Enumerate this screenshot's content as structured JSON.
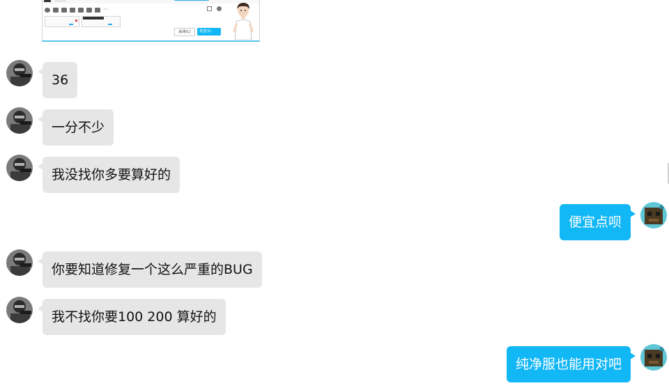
{
  "embedded_screenshot": {
    "close_button_label": "关闭(C)",
    "send_button_label": "发送(S)"
  },
  "messages": [
    {
      "side": "left",
      "text": "36"
    },
    {
      "side": "left",
      "text": "一分不少"
    },
    {
      "side": "left",
      "text": "我没找你多要算好的"
    },
    {
      "side": "right",
      "text": "便宜点呗"
    },
    {
      "side": "left",
      "text": "你要知道修复一个这么严重的BUG"
    },
    {
      "side": "left",
      "text": "我不找你要100 200 算好的"
    },
    {
      "side": "right",
      "text": "纯净服也能用对吧"
    }
  ],
  "colors": {
    "incoming_bubble": "#e6e6e6",
    "outgoing_bubble": "#12b7f5",
    "outgoing_text": "#ffffff",
    "incoming_text": "#111111"
  },
  "avatars": {
    "incoming": "masked-person-avatar",
    "outgoing": "pixel-character-avatar"
  }
}
